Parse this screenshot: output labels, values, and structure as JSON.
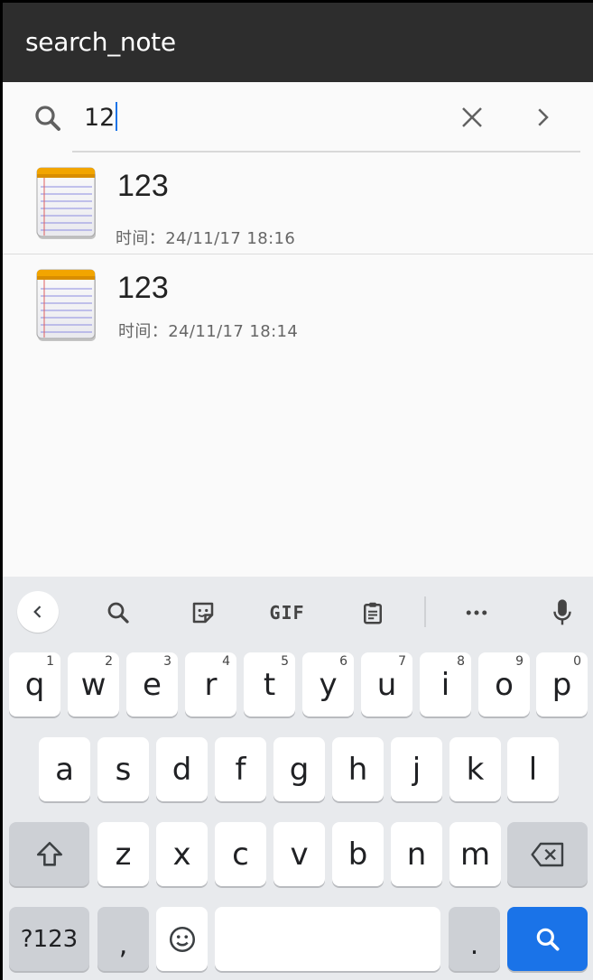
{
  "appbar": {
    "title": "search_note"
  },
  "search": {
    "query": "12"
  },
  "notes": [
    {
      "title": "123",
      "time": "时间：24/11/17  18:16"
    },
    {
      "title": "123",
      "time": "时间：24/11/17  18:14"
    }
  ],
  "keyboard": {
    "toolbar": {
      "gif_label": "GIF"
    },
    "row1": [
      {
        "label": "q",
        "hint": "1"
      },
      {
        "label": "w",
        "hint": "2"
      },
      {
        "label": "e",
        "hint": "3"
      },
      {
        "label": "r",
        "hint": "4"
      },
      {
        "label": "t",
        "hint": "5"
      },
      {
        "label": "y",
        "hint": "6"
      },
      {
        "label": "u",
        "hint": "7"
      },
      {
        "label": "i",
        "hint": "8"
      },
      {
        "label": "o",
        "hint": "9"
      },
      {
        "label": "p",
        "hint": "0"
      }
    ],
    "row2": [
      "a",
      "s",
      "d",
      "f",
      "g",
      "h",
      "j",
      "k",
      "l"
    ],
    "row3": [
      "z",
      "x",
      "c",
      "v",
      "b",
      "n",
      "m"
    ],
    "symbols_label": "?123",
    "comma_label": ",",
    "period_label": "."
  },
  "colors": {
    "appbar": "#2d2d2d",
    "accent": "#1a73e8",
    "keyboard_bg": "#e8eaed"
  }
}
